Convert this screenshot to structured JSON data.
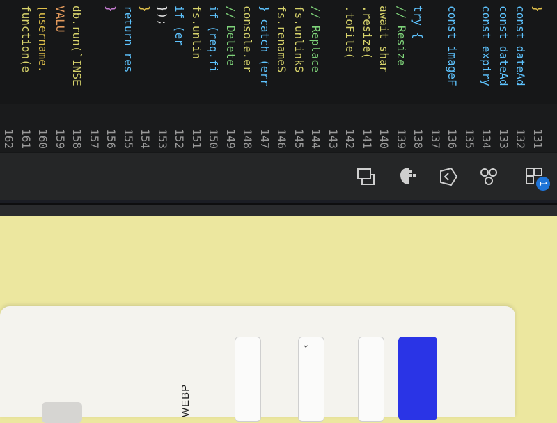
{
  "editor": {
    "line_numbers": [
      "131",
      "132",
      "133",
      "134",
      "135",
      "136",
      "137",
      "138",
      "139",
      "140",
      "141",
      "142",
      "143",
      "144",
      "145",
      "146",
      "147",
      "148",
      "149",
      "150",
      "151",
      "152",
      "153",
      "154",
      "155",
      "156",
      "157",
      "158",
      "159",
      "160",
      "161",
      "162"
    ],
    "lines": [
      {
        "t": "}",
        "c": "br"
      },
      {
        "t": "const dateAd",
        "c": "kw"
      },
      {
        "t": "const dateAd",
        "c": "kw"
      },
      {
        "t": "const expiry",
        "c": "kw"
      },
      {
        "t": "",
        "c": "tx"
      },
      {
        "t": "const imageF",
        "c": "kw"
      },
      {
        "t": "",
        "c": "tx"
      },
      {
        "t": "try {",
        "c": "kw"
      },
      {
        "t": "// Resize",
        "c": "cm"
      },
      {
        "t": "await shar",
        "c": "fn"
      },
      {
        "t": "  .resize(",
        "c": "fn"
      },
      {
        "t": "  .toFile(",
        "c": "fn"
      },
      {
        "t": "",
        "c": "tx"
      },
      {
        "t": "// Replace",
        "c": "cm"
      },
      {
        "t": "fs.unlinkS",
        "c": "fn"
      },
      {
        "t": "fs.renameS",
        "c": "fn"
      },
      {
        "t": "} catch (err",
        "c": "kw"
      },
      {
        "t": "console.er",
        "c": "fn"
      },
      {
        "t": "// Delete",
        "c": "cm"
      },
      {
        "t": "if (req.fi",
        "c": "kw"
      },
      {
        "t": "  fs.unlin",
        "c": "fn"
      },
      {
        "t": "    if (er",
        "c": "kw"
      },
      {
        "t": "  });",
        "c": "tx"
      },
      {
        "t": "}",
        "c": "br"
      },
      {
        "t": "return res",
        "c": "kw"
      },
      {
        "t": "}",
        "c": "br2"
      },
      {
        "t": "",
        "c": "tx"
      },
      {
        "t": "db.run(`INSE",
        "c": "fn"
      },
      {
        "t": "    VALU",
        "c": "st"
      },
      {
        "t": "[username.",
        "c": "br"
      },
      {
        "t": "function(e",
        "c": "fn"
      },
      {
        "t": "",
        "c": "tx"
      }
    ]
  },
  "activity_bar": {
    "badge_count": "1",
    "icons": [
      "extensions-icon",
      "source-control-icon",
      "debug-icon",
      "docker-icon",
      "remote-explorer-icon"
    ]
  },
  "form": {
    "format_label": "WEBP"
  }
}
